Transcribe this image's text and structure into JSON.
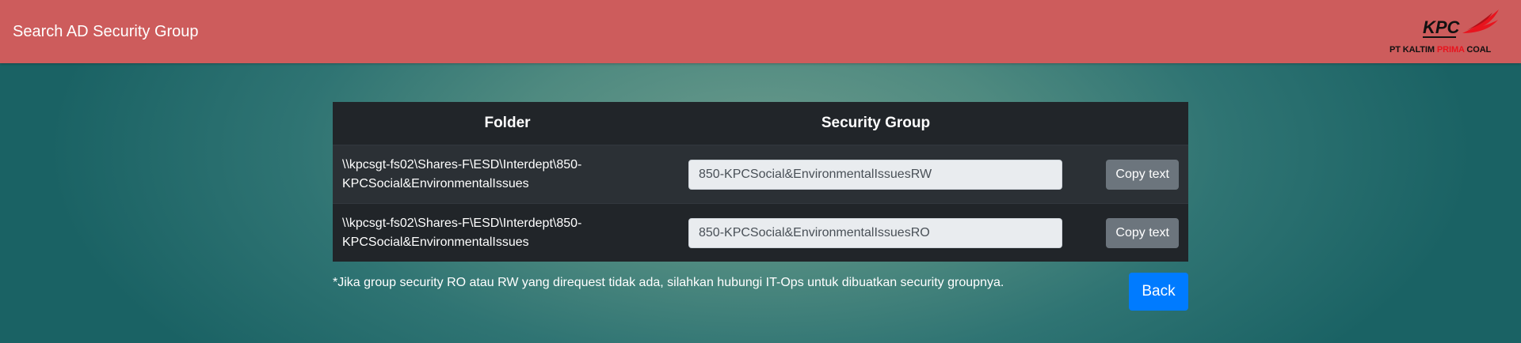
{
  "header": {
    "title": "Search AD Security Group",
    "logo": {
      "mark_text": "KPC",
      "company_part1": "PT KALTIM ",
      "company_accent": "PRIMA",
      "company_part2": " COAL",
      "accent_color": "#e8141e"
    },
    "bar_color": "#cd5c5c"
  },
  "table": {
    "columns": [
      "Folder",
      "Security Group",
      ""
    ],
    "rows": [
      {
        "folder_line1": "\\\\kpcsgt-fs02\\Shares-F\\ESD\\Interdept\\850-",
        "folder_line2": "KPCSocial&EnvironmentalIssues",
        "security_group": "850-KPCSocial&EnvironmentalIssuesRW",
        "copy_label": "Copy text"
      },
      {
        "folder_line1": "\\\\kpcsgt-fs02\\Shares-F\\ESD\\Interdept\\850-",
        "folder_line2": "KPCSocial&EnvironmentalIssues",
        "security_group": "850-KPCSocial&EnvironmentalIssuesRO",
        "copy_label": "Copy text"
      }
    ]
  },
  "note": "*Jika group security RO atau RW yang direquest tidak ada, silahkan hubungi IT-Ops untuk dibuatkan security groupnya.",
  "back_label": "Back",
  "colors": {
    "back_button": "#007bff",
    "copy_button": "#6c757d",
    "table_dark": "#212529"
  }
}
